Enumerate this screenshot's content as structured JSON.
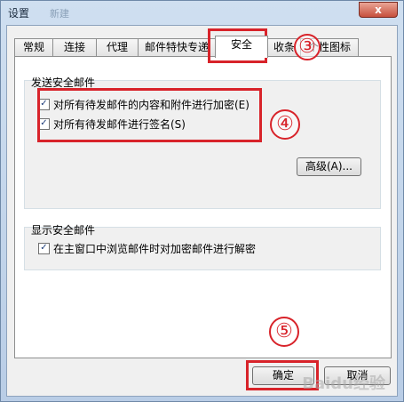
{
  "window": {
    "title": "设置",
    "title_ghost": "新建",
    "close_glyph": "x"
  },
  "tabs": [
    {
      "label": "常规"
    },
    {
      "label": "连接"
    },
    {
      "label": "代理"
    },
    {
      "label": "邮件特快专递"
    },
    {
      "label": "安全"
    },
    {
      "label": "收条"
    },
    {
      "label": "个性图标"
    }
  ],
  "send_group": {
    "title": "发送安全邮件",
    "encrypt": {
      "label": "对所有待发邮件的内容和附件进行加密(E)",
      "checked": true
    },
    "sign": {
      "label": "对所有待发邮件进行签名(S)",
      "checked": true
    },
    "advanced_label": "高级(A)..."
  },
  "view_group": {
    "title": "显示安全邮件",
    "decrypt": {
      "label": "在主窗口中浏览邮件时对加密邮件进行解密",
      "checked": true
    }
  },
  "footer": {
    "ok_label": "确定",
    "cancel_label": "取消"
  },
  "annotations": {
    "step3": "③",
    "step4": "④",
    "step5": "⑤",
    "color": "#d8232a"
  },
  "watermark": "Baidu经验"
}
